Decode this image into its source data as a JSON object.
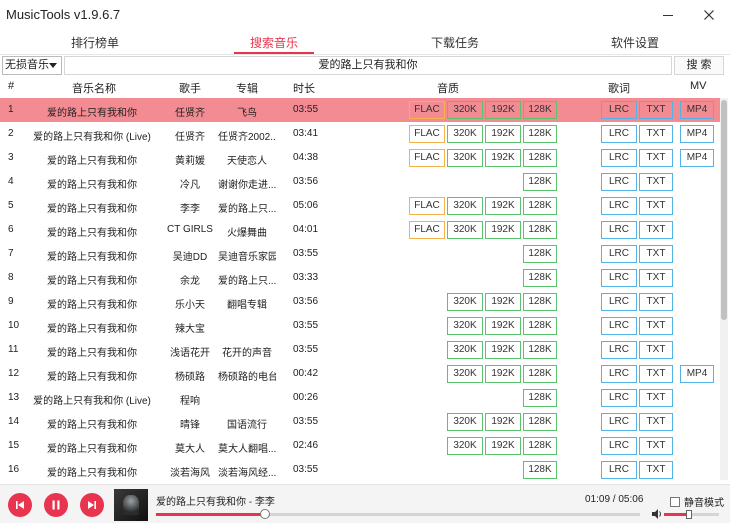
{
  "app": {
    "title": "MusicTools v1.9.6.7"
  },
  "tabs": [
    {
      "label": "排行榜单",
      "active": false
    },
    {
      "label": "搜索音乐",
      "active": true
    },
    {
      "label": "下载任务",
      "active": false
    },
    {
      "label": "软件设置",
      "active": false
    }
  ],
  "search": {
    "quality": "无损音乐",
    "query": "爱的路上只有我和你",
    "button": "搜 索"
  },
  "table": {
    "headers": {
      "index": "#",
      "name": "音乐名称",
      "singer": "歌手",
      "album": "专辑",
      "duration": "时长",
      "quality": "音质",
      "lyrics": "歌词",
      "mv": "MV"
    },
    "tag_labels": {
      "flac": "FLAC",
      "q320": "320K",
      "q192": "192K",
      "q128": "128K",
      "lrc": "LRC",
      "txt": "TXT",
      "mp4": "MP4"
    },
    "selected_index": 0,
    "rows": [
      {
        "idx": "1",
        "name": "爱的路上只有我和你",
        "singer": "任贤齐",
        "album": "飞鸟",
        "time": "03:55",
        "flac": true,
        "q320": true,
        "q192": true,
        "q128": true,
        "lrc": true,
        "txt": true,
        "mp4": true
      },
      {
        "idx": "2",
        "name": "爱的路上只有我和你 (Live)",
        "singer": "任贤齐",
        "album": "任贤齐2002...",
        "time": "03:41",
        "flac": true,
        "q320": true,
        "q192": true,
        "q128": true,
        "lrc": true,
        "txt": true,
        "mp4": true
      },
      {
        "idx": "3",
        "name": "爱的路上只有我和你",
        "singer": "黄莉媛",
        "album": "天使恋人",
        "time": "04:38",
        "flac": true,
        "q320": true,
        "q192": true,
        "q128": true,
        "lrc": true,
        "txt": true,
        "mp4": true
      },
      {
        "idx": "4",
        "name": "爱的路上只有我和你",
        "singer": "冷凡",
        "album": "谢谢你走进...",
        "time": "03:56",
        "flac": false,
        "q320": false,
        "q192": false,
        "q128": true,
        "lrc": true,
        "txt": true,
        "mp4": false
      },
      {
        "idx": "5",
        "name": "爱的路上只有我和你",
        "singer": "李李",
        "album": "爱的路上只...",
        "time": "05:06",
        "flac": true,
        "q320": true,
        "q192": true,
        "q128": true,
        "lrc": true,
        "txt": true,
        "mp4": false
      },
      {
        "idx": "6",
        "name": "爱的路上只有我和你",
        "singer": "CT GIRLS",
        "album": "火爆舞曲",
        "time": "04:01",
        "flac": true,
        "q320": true,
        "q192": true,
        "q128": true,
        "lrc": true,
        "txt": true,
        "mp4": false
      },
      {
        "idx": "7",
        "name": "爱的路上只有我和你",
        "singer": "吴迪DD",
        "album": "吴迪音乐家园",
        "time": "03:55",
        "flac": false,
        "q320": false,
        "q192": false,
        "q128": true,
        "lrc": true,
        "txt": true,
        "mp4": false
      },
      {
        "idx": "8",
        "name": "爱的路上只有我和你",
        "singer": "余龙",
        "album": "爱的路上只...",
        "time": "03:33",
        "flac": false,
        "q320": false,
        "q192": false,
        "q128": true,
        "lrc": true,
        "txt": true,
        "mp4": false
      },
      {
        "idx": "9",
        "name": "爱的路上只有我和你",
        "singer": "乐小天",
        "album": "翻唱专辑",
        "time": "03:56",
        "flac": false,
        "q320": true,
        "q192": true,
        "q128": true,
        "lrc": true,
        "txt": true,
        "mp4": false
      },
      {
        "idx": "10",
        "name": "爱的路上只有我和你",
        "singer": "辣大宝",
        "album": "",
        "time": "03:55",
        "flac": false,
        "q320": true,
        "q192": true,
        "q128": true,
        "lrc": true,
        "txt": true,
        "mp4": false
      },
      {
        "idx": "11",
        "name": "爱的路上只有我和你",
        "singer": "浅语花开",
        "album": "花开的声音",
        "time": "03:55",
        "flac": false,
        "q320": true,
        "q192": true,
        "q128": true,
        "lrc": true,
        "txt": true,
        "mp4": false
      },
      {
        "idx": "12",
        "name": "爱的路上只有我和你",
        "singer": "杨硕路",
        "album": "杨硕路的电台",
        "time": "00:42",
        "flac": false,
        "q320": true,
        "q192": true,
        "q128": true,
        "lrc": true,
        "txt": true,
        "mp4": true
      },
      {
        "idx": "13",
        "name": "爱的路上只有我和你 (Live)",
        "singer": "程响",
        "album": "",
        "time": "00:26",
        "flac": false,
        "q320": false,
        "q192": false,
        "q128": true,
        "lrc": true,
        "txt": true,
        "mp4": false
      },
      {
        "idx": "14",
        "name": "爱的路上只有我和你",
        "singer": "晴锋",
        "album": "国语流行",
        "time": "03:55",
        "flac": false,
        "q320": true,
        "q192": true,
        "q128": true,
        "lrc": true,
        "txt": true,
        "mp4": false
      },
      {
        "idx": "15",
        "name": "爱的路上只有我和你",
        "singer": "莫大人",
        "album": "莫大人翻唱...",
        "time": "02:46",
        "flac": false,
        "q320": true,
        "q192": true,
        "q128": true,
        "lrc": true,
        "txt": true,
        "mp4": false
      },
      {
        "idx": "16",
        "name": "爱的路上只有我和你",
        "singer": "淡若海风",
        "album": "淡若海风经...",
        "time": "03:55",
        "flac": false,
        "q320": false,
        "q192": false,
        "q128": true,
        "lrc": true,
        "txt": true,
        "mp4": false
      }
    ]
  },
  "player": {
    "now_playing": "爱的路上只有我和你 - 李李",
    "time": "01:09 / 05:06",
    "progress_fraction": 0.225,
    "volume_fraction": 0.45,
    "mute_label": "静音模式",
    "mute_checked": false
  },
  "icons": {
    "prev": "skip-previous-icon",
    "pause": "pause-icon",
    "next": "skip-next-icon",
    "volume": "volume-icon",
    "minimize": "minimize-icon",
    "close": "close-icon",
    "dropdown": "chevron-down-icon"
  },
  "colors": {
    "accent": "#e8344e",
    "selected_row": "#f38b93",
    "flac": "#f5b24a",
    "bitrate": "#5ac36b",
    "lyric_mv": "#54b3e6"
  }
}
